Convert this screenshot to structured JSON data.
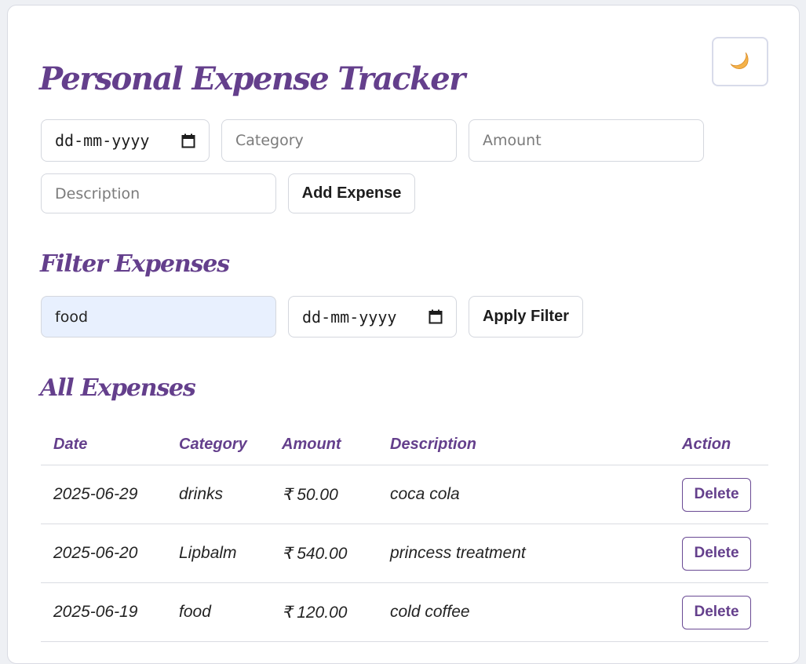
{
  "theme_toggle": {
    "icon": "crescent-moon-icon"
  },
  "title": "Personal Expense Tracker",
  "add_form": {
    "date_placeholder": "dd-mm-yyyy",
    "category_placeholder": "Category",
    "amount_placeholder": "Amount",
    "description_placeholder": "Description",
    "add_button": "Add Expense"
  },
  "filter": {
    "heading": "Filter Expenses",
    "category_value": "food",
    "date_placeholder": "dd-mm-yyyy",
    "apply_button": "Apply Filter"
  },
  "expenses": {
    "heading": "All Expenses",
    "columns": [
      "Date",
      "Category",
      "Amount",
      "Description",
      "Action"
    ],
    "rows": [
      {
        "date": "2025-06-29",
        "category": "drinks",
        "amount": "₹ 50.00",
        "description": "coca cola",
        "action": "Delete"
      },
      {
        "date": "2025-06-20",
        "category": "Lipbalm",
        "amount": "₹ 540.00",
        "description": "princess treatment",
        "action": "Delete"
      },
      {
        "date": "2025-06-19",
        "category": "food",
        "amount": "₹ 120.00",
        "description": "cold coffee",
        "action": "Delete"
      }
    ]
  },
  "colors": {
    "accent": "#643f8c",
    "filled_input": "#e8f0fe"
  }
}
